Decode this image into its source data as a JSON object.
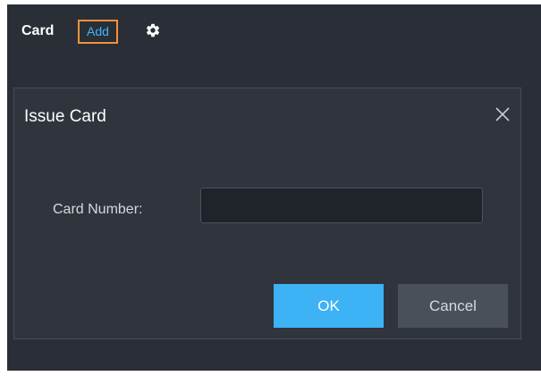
{
  "toolbar": {
    "card_label": "Card",
    "add_label": "Add",
    "settings_icon": "gear-icon"
  },
  "dialog": {
    "title": "Issue Card",
    "close_icon": "close-icon",
    "card_number_label": "Card Number:",
    "card_number_value": "",
    "ok_label": "OK",
    "cancel_label": "Cancel"
  },
  "colors": {
    "background": "#2a2e36",
    "dialog_background": "#2f343d",
    "accent": "#3db2f5",
    "add_highlight_border": "#f0933c",
    "add_link": "#3fb6ff",
    "cancel_button": "#4a505a"
  }
}
